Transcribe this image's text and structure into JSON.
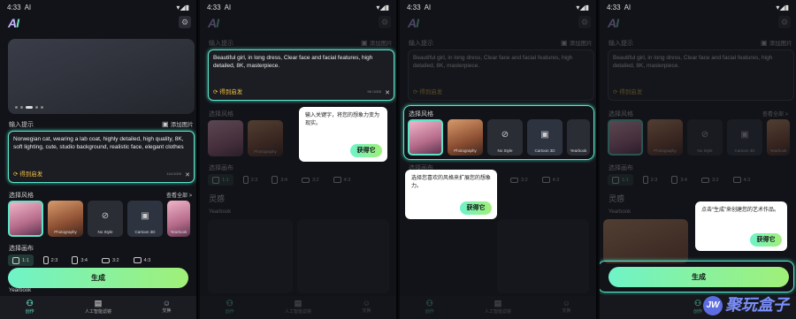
{
  "status": {
    "time": "4:33",
    "tag": "AI"
  },
  "app": {
    "logo": "AI"
  },
  "labels": {
    "prompt_label": "输入提示",
    "add_image": "添加图片",
    "inspire": "得到启发",
    "counter": "141/1000",
    "counter2": "96 /1000",
    "style_label": "选择风格",
    "view_all": "查看全部 >",
    "ratio_label": "选择画布",
    "inspiration": "灵感",
    "yearbook": "Yearbook",
    "generate": "生成"
  },
  "prompt1": "Norwegian cat, wearing a lab coat, highly detailed, high quality, 8K, soft lighting, cute, studio background, realistic face, elegant clothes",
  "prompt2": "Beautiful girl, in long dress, Clear face and facial features, high detailed, 8K, masterpiece.",
  "styles": [
    "",
    "Photography",
    "No Style",
    "Cartoon 3D",
    "Yearbook"
  ],
  "ratios": [
    "1:1",
    "2:3",
    "3:4",
    "3:2",
    "4:3"
  ],
  "nav": [
    "创作",
    "人工智能滤镜",
    "交换"
  ],
  "tips": {
    "t1": "输入关键字，将您的想象力变为现实。",
    "t2": "选择您喜欢的风格来扩展您的想象力。",
    "t3": "点击“生成”来创建您的艺术作品。",
    "btn": "获得它"
  },
  "watermark": "聚玩盒子",
  "watermark_badge": "JW"
}
